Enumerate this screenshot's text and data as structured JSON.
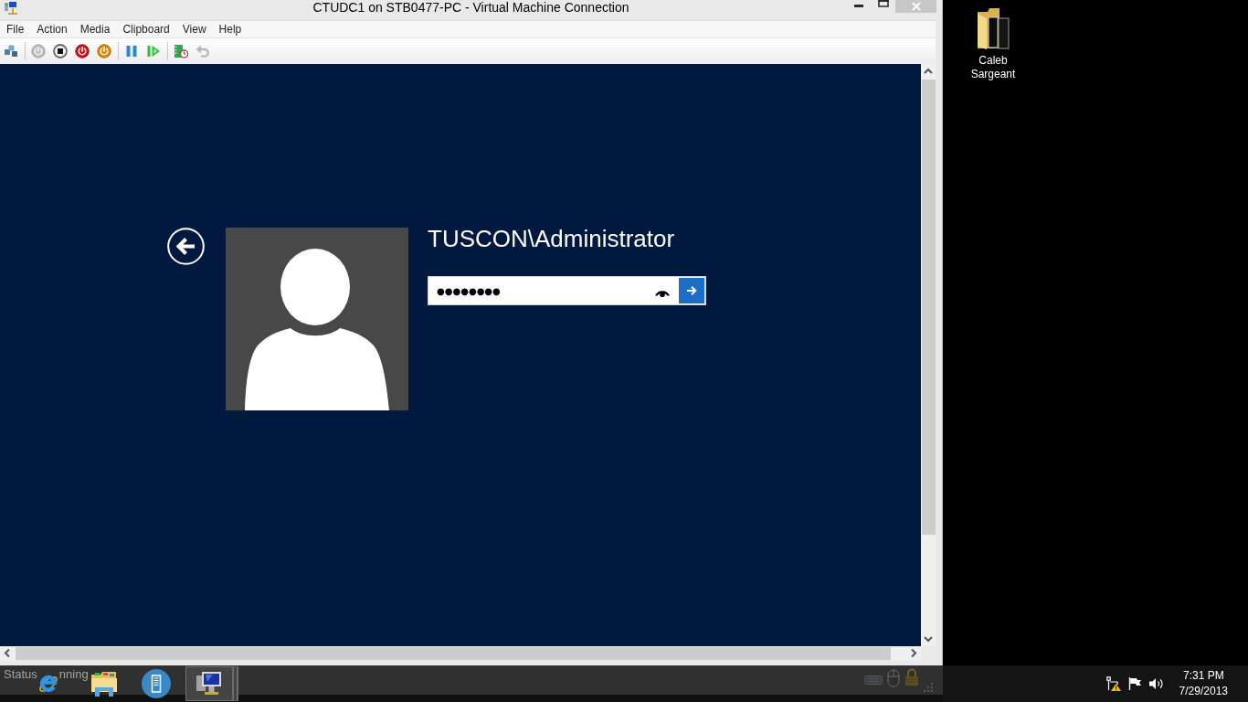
{
  "window": {
    "title": "CTUDC1 on STB0477-PC - Virtual Machine Connection"
  },
  "menu": [
    "File",
    "Action",
    "Media",
    "Clipboard",
    "View",
    "Help"
  ],
  "toolbar": {
    "groups": [
      [
        {
          "kind": "ctrl_alt_del",
          "disabled": false
        }
      ],
      [
        {
          "kind": "start",
          "disabled": true
        },
        {
          "kind": "turn_off",
          "disabled": false
        },
        {
          "kind": "shut_down",
          "disabled": false
        },
        {
          "kind": "save",
          "disabled": false
        }
      ],
      [
        {
          "kind": "pause",
          "disabled": false
        },
        {
          "kind": "resume",
          "disabled": false
        }
      ],
      [
        {
          "kind": "checkpoint",
          "disabled": false
        },
        {
          "kind": "revert",
          "disabled": true
        }
      ]
    ]
  },
  "sign_in": {
    "account": "TUSCON\\Administrator",
    "password": "●●●●●●●●"
  },
  "status_bar": {
    "texts": [
      "Status",
      "nning"
    ]
  },
  "desktop_icons": [
    {
      "label": "Caleb Sargeant"
    }
  ],
  "taskbar": {
    "apps": [
      {
        "kind": "browser",
        "selected": false
      },
      {
        "kind": "files",
        "selected": false
      },
      {
        "kind": "server",
        "selected": false
      },
      {
        "kind": "vm_connection",
        "selected": true
      }
    ],
    "clock": {
      "time": "7:31 PM",
      "date": "7/29/2013"
    }
  }
}
